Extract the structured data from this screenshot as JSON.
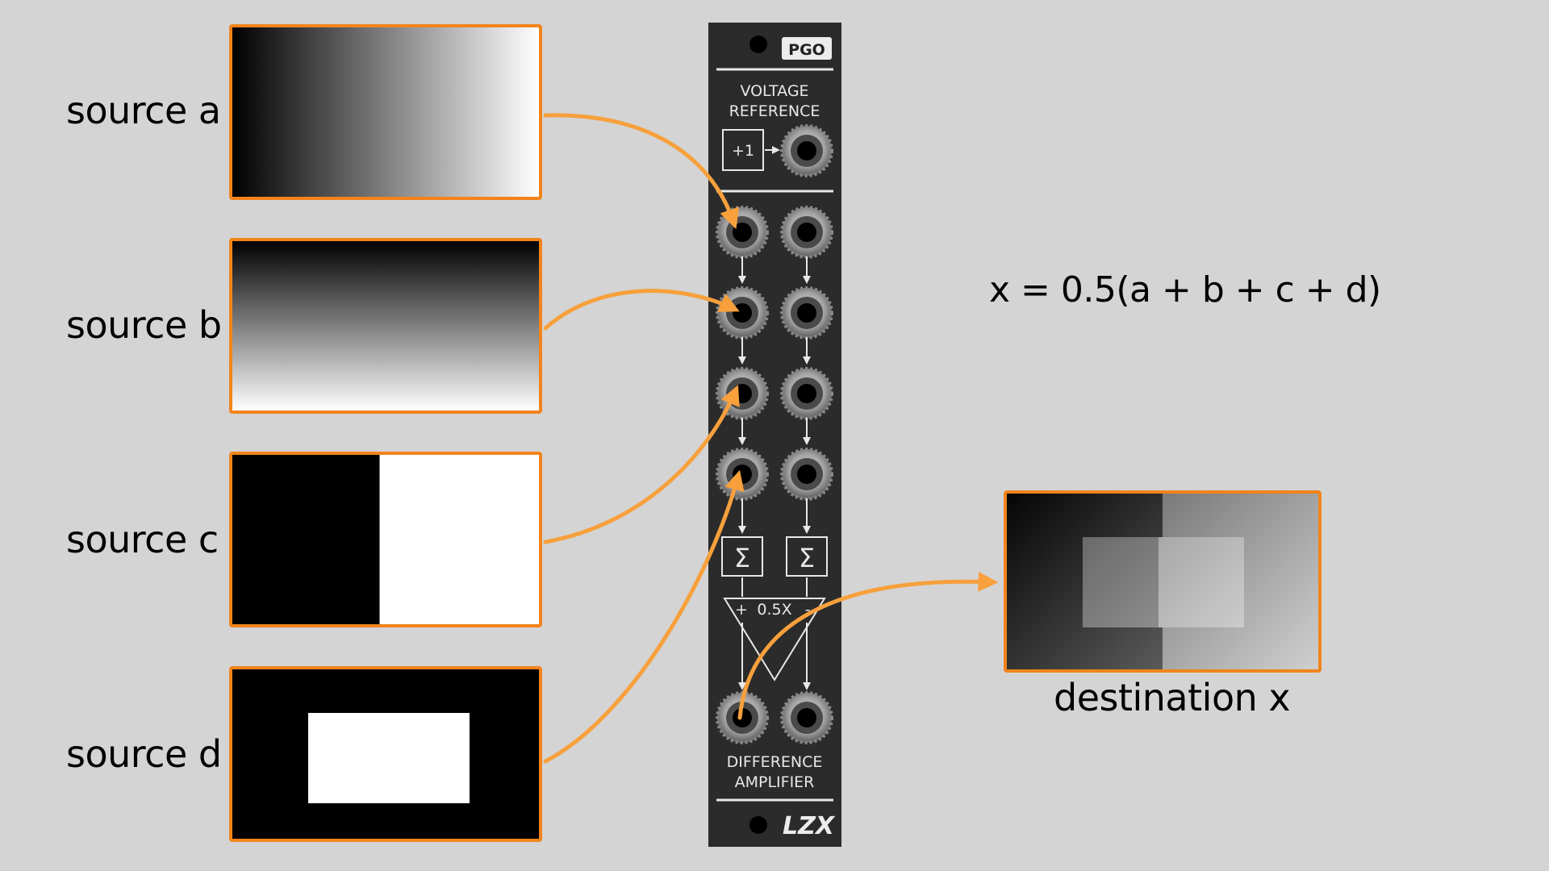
{
  "sources": [
    {
      "label": "source a"
    },
    {
      "label": "source b"
    },
    {
      "label": "source c"
    },
    {
      "label": "source d"
    }
  ],
  "destination": {
    "label": "destination x"
  },
  "equation": "x = 0.5(a + b + c + d)",
  "module": {
    "brand_badge": "PGO",
    "section_top": [
      "VOLTAGE",
      "REFERENCE"
    ],
    "plus_one": "+1",
    "sum_symbol": "Σ",
    "amp_gain": "0.5X",
    "amp_plus": "+",
    "amp_minus": "-",
    "section_bottom": [
      "DIFFERENCE",
      "AMPLIFIER"
    ],
    "logo": "LZX"
  },
  "colors": {
    "accent": "#f2841c",
    "panel": "#2b2b2b",
    "background": "#d4d4d4"
  }
}
